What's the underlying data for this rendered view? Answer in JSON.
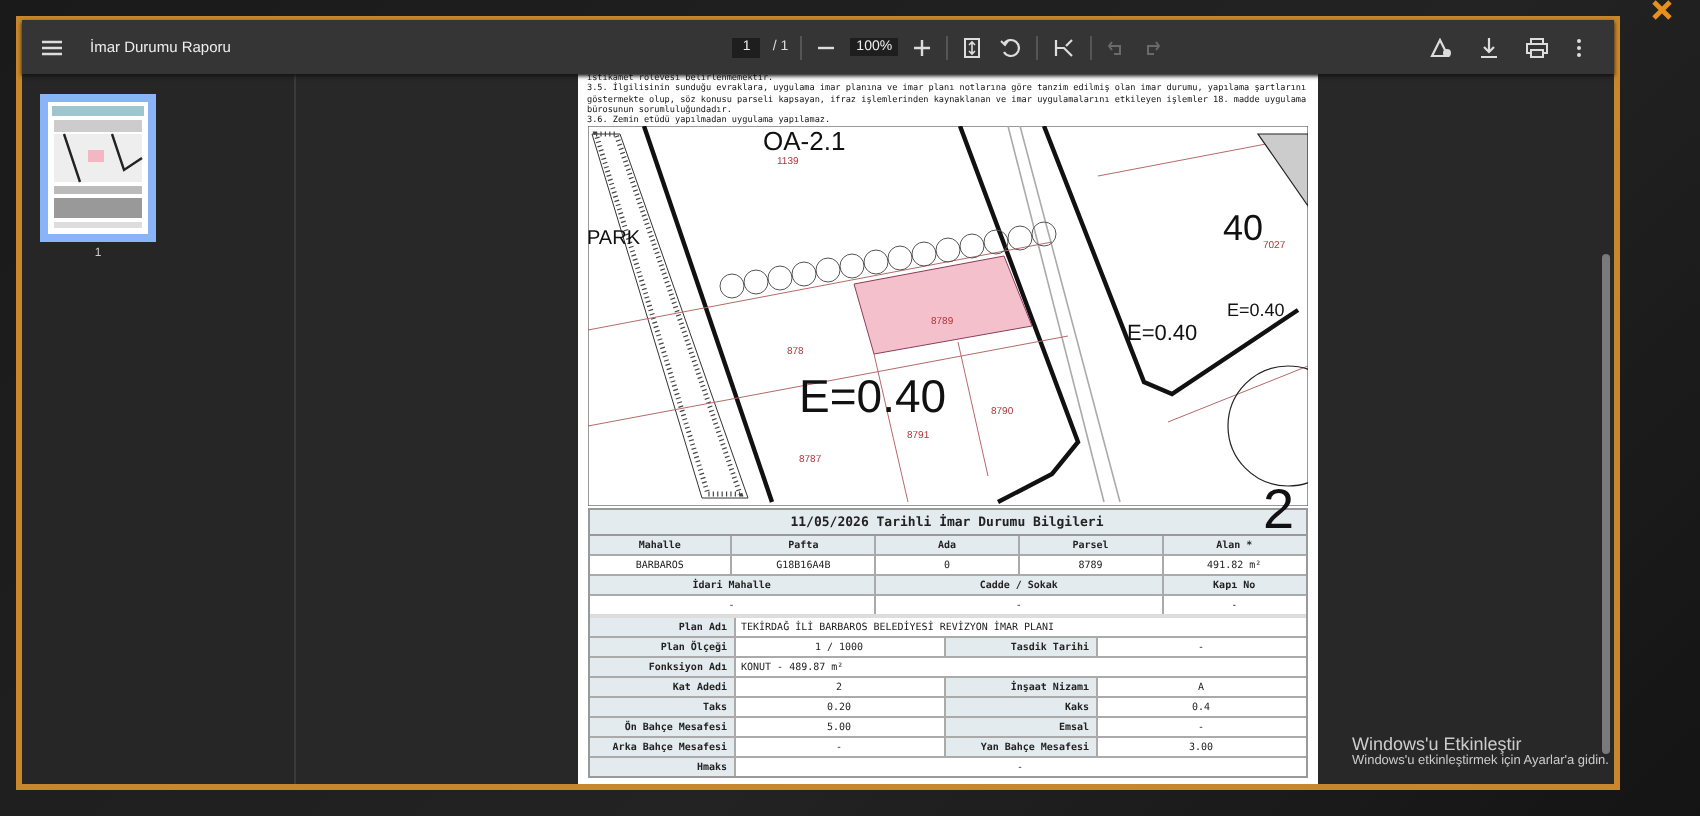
{
  "toolbar": {
    "title": "İmar Durumu Raporu",
    "page_input": "1",
    "page_total": "/ 1",
    "zoom": "100%",
    "undo_disabled": true,
    "redo_disabled": true
  },
  "sidebar": {
    "thumbnails": [
      {
        "label": "1",
        "selected": true
      }
    ]
  },
  "document": {
    "notes": "istikamet rölevesi belirlenmemektir.\n3.5. İlgilisinin sunduğu evraklara, uygulama imar planına ve imar planı notlarına göre tanzim edilmiş olan imar durumu, yapılama şartlarını göstermekte olup, söz konusu parseli kapsayan, ifraz işlemlerinden kaynaklanan ve imar uygulamalarını etkileyen işlemler 18. madde uygulama bürosunun sorumluluğundadır.\n3.6. Zemin etüdü yapılmadan uygulama yapılamaz.",
    "map_labels": [
      {
        "text": "OA-2.1",
        "kind": "zone"
      },
      {
        "text": "1139",
        "kind": "parcel"
      },
      {
        "text": "PARK",
        "kind": "zone"
      },
      {
        "text": "40",
        "kind": "zone"
      },
      {
        "text": "7027",
        "kind": "parcel"
      },
      {
        "text": "8789",
        "kind": "parcel"
      },
      {
        "text": "878",
        "kind": "parcel"
      },
      {
        "text": "E=0.40",
        "kind": "density"
      },
      {
        "text": "E=0.40",
        "kind": "density"
      },
      {
        "text": "E=0.40",
        "kind": "density"
      },
      {
        "text": "8790",
        "kind": "parcel"
      },
      {
        "text": "8791",
        "kind": "parcel"
      },
      {
        "text": "8787",
        "kind": "parcel"
      },
      {
        "text": "2",
        "kind": "zone"
      }
    ],
    "table_title": "11/05/2026 Tarihli İmar Durumu Bilgileri",
    "top_rows": [
      {
        "kind": "head",
        "cells": [
          "Mahalle",
          "Pafta",
          "Ada",
          "Parsel",
          "Alan *"
        ]
      },
      {
        "kind": "value",
        "cells": [
          "BARBAROS",
          "G18B16A4B",
          "0",
          "8789",
          "491.82 m²"
        ]
      },
      {
        "kind": "head",
        "cells": [
          "İdari Mahalle",
          "Cadde / Sokak",
          "Kapı No"
        ]
      },
      {
        "kind": "value",
        "cells": [
          "-",
          "-",
          "-"
        ]
      }
    ],
    "detail_rows": [
      {
        "kind": "wide",
        "cells": [
          "Plan Adı",
          "TEKİRDAĞ İLİ BARBAROS BELEDİYESİ REVİZYON İMAR PLANI"
        ]
      },
      {
        "kind": "pair",
        "cells": [
          "Plan Ölçeği",
          "1 / 1000",
          "Tasdik Tarihi",
          "-"
        ]
      },
      {
        "kind": "wide",
        "cells": [
          "Fonksiyon Adı",
          "KONUT - 489.87 m²"
        ]
      },
      {
        "kind": "pair",
        "cells": [
          "Kat Adedi",
          "2",
          "İnşaat Nizamı",
          "A"
        ]
      },
      {
        "kind": "pair",
        "cells": [
          "Taks",
          "0.20",
          "Kaks",
          "0.4"
        ]
      },
      {
        "kind": "pair",
        "cells": [
          "Ön Bahçe Mesafesi",
          "5.00",
          "Emsal",
          "-"
        ]
      },
      {
        "kind": "pair",
        "cells": [
          "Arka Bahçe Mesafesi",
          "-",
          "Yan Bahçe Mesafesi",
          "3.00"
        ]
      },
      {
        "kind": "center",
        "cells": [
          "Hmaks",
          "-"
        ]
      }
    ]
  },
  "os_notice": {
    "title": "Windows'u Etkinleştir",
    "text": "Windows'u etkinleştirmek için Ayarlar'a gidin."
  }
}
